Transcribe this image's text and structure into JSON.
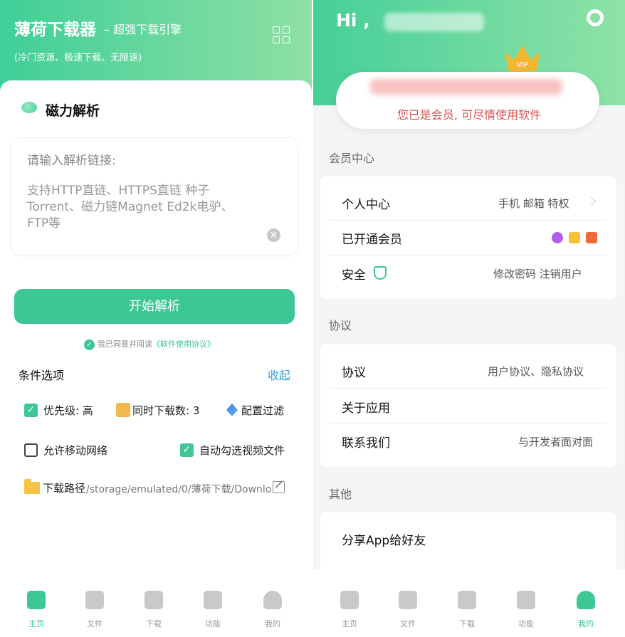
{
  "left": {
    "header": {
      "title": "薄荷下载器",
      "subtitle": "– 超强下载引擎",
      "tagline": "(冷门资源、极速下载、无限速)"
    },
    "magnet": {
      "title": "磁力解析",
      "input_placeholder": "请输入解析链接:",
      "input_hint": "支持HTTP直链、HTTPS直链 种子Torrent、磁力链Magnet Ed2k电驴、FTP等"
    },
    "start_button": "开始解析",
    "agree": {
      "text": "我已同意并阅读",
      "link": "《软件使用协议》"
    },
    "options": {
      "title": "条件选项",
      "collapse": "收起",
      "priority": "优先级: 高",
      "concurrent": "同时下载数: 3",
      "filter": "配置过滤",
      "mobile_network": "允许移动网络",
      "auto_video": "自动勾选视频文件",
      "path_label": "下载路径",
      "path_value": "/storage/emulated/0/薄荷下载/Downlo..."
    },
    "nav": [
      "主页",
      "文件",
      "下载",
      "功能",
      "我的"
    ]
  },
  "right": {
    "header": {
      "greeting": "Hi ,",
      "member_text": "您已是会员, 可尽情使用软件"
    },
    "member_center": {
      "title": "会员中心",
      "rows": [
        {
          "label": "个人中心",
          "value": "手机 邮箱 特权"
        },
        {
          "label": "已开通会员",
          "value": ""
        },
        {
          "label": "安全",
          "value": "修改密码   注销用户"
        }
      ]
    },
    "agreement": {
      "title": "协议",
      "rows": [
        {
          "label": "协议",
          "value": "用户协议、隐私协议"
        },
        {
          "label": "关于应用",
          "value": ""
        },
        {
          "label": "联系我们",
          "value": "与开发者面对面"
        }
      ]
    },
    "other": {
      "title": "其他",
      "rows": [
        {
          "label": "分享App给好友"
        }
      ]
    },
    "nav": [
      "主页",
      "文件",
      "下载",
      "功能",
      "我的"
    ]
  },
  "colors": {
    "accent": "#3dc795",
    "link": "#3a9fd8",
    "member_red": "#d9534f"
  }
}
